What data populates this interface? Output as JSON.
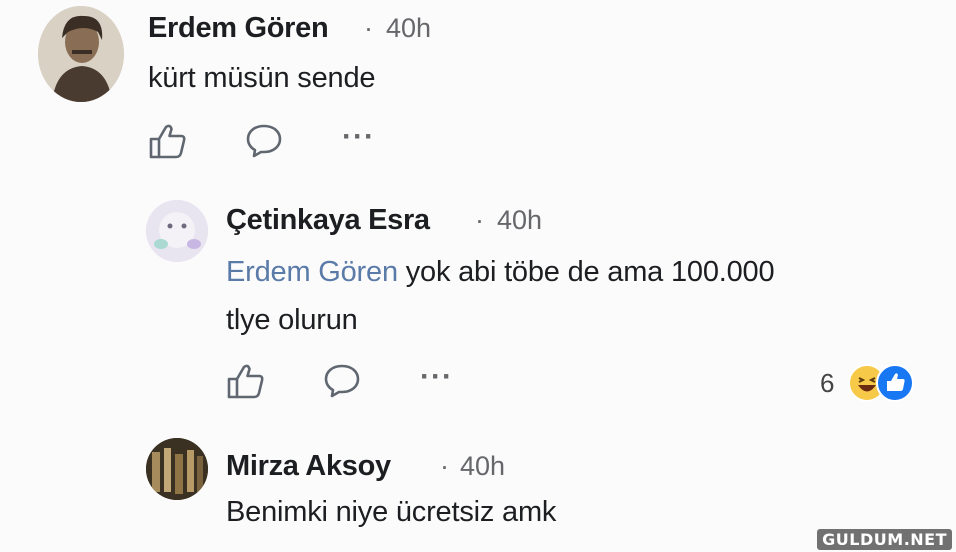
{
  "comments": [
    {
      "author": "Erdem Gören",
      "separator": "·",
      "time": "40h",
      "text": "kürt müsün sende"
    },
    {
      "author": "Çetinkaya Esra",
      "separator": "·",
      "time": "40h",
      "mention": "Erdem Gören",
      "text_line1": " yok abi töbe de ama 100.000",
      "text_line2": "tlye olurun",
      "reaction_count": "6"
    },
    {
      "author": "Mirza Aksoy",
      "separator": "·",
      "time": "40h",
      "text": "Benimki niye ücretsiz amk"
    }
  ],
  "actions": {
    "more": "···"
  },
  "icons": [
    "like-icon",
    "comment-icon",
    "more-icon",
    "haha-reaction-icon",
    "like-reaction-icon"
  ],
  "colors": {
    "mention": "#5a7aa8",
    "meta": "#65676b",
    "like_blue": "#1877f2",
    "haha_yellow": "#f7c948"
  },
  "watermark": "GULDUM.NET"
}
